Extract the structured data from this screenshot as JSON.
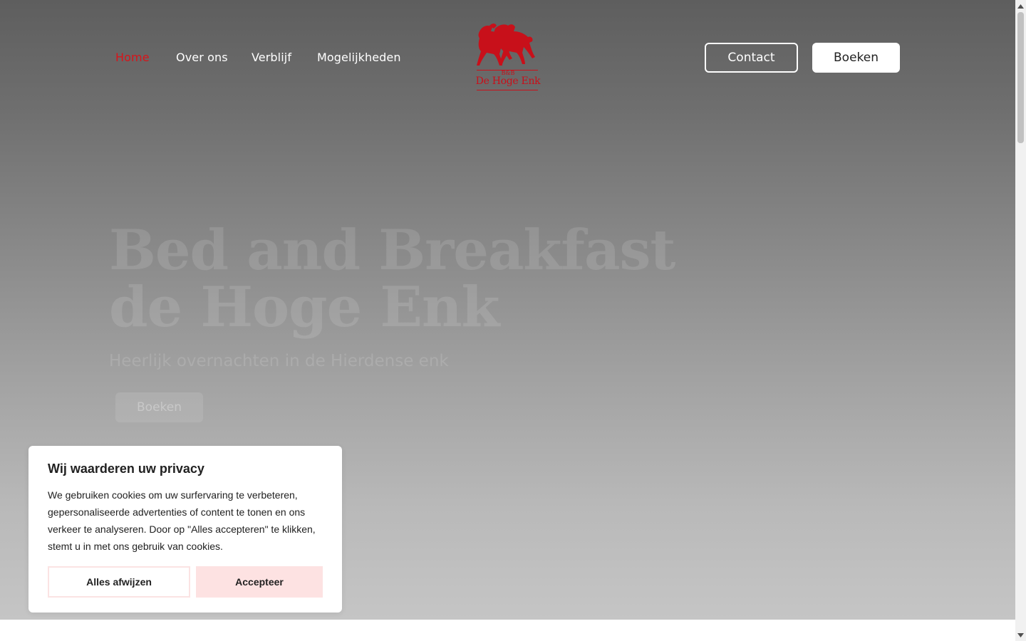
{
  "nav": {
    "items": [
      {
        "label": "Home"
      },
      {
        "label": "Over ons"
      },
      {
        "label": "Verblijf"
      },
      {
        "label": "Mogelijkheden"
      }
    ],
    "contact_label": "Contact",
    "book_label": "Boeken"
  },
  "logo": {
    "small": "B&B",
    "name": "De Hoge Enk",
    "icon": "horses-logo-icon",
    "color": "#c8101a"
  },
  "hero": {
    "title_line1": "Bed and Breakfast",
    "title_line2": "de Hoge Enk",
    "subtitle": "Heerlijk overnachten in de Hierdense enk",
    "button_label": "Boeken"
  },
  "cookie": {
    "title": "Wij waarderen uw privacy",
    "text": "We gebruiken cookies om uw surfervaring te verbeteren, gepersonaliseerde advertenties of content te tonen en ons verkeer te analyseren. Door op \"Alles accepteren\" te klikken, stemt u in met ons gebruik van cookies.",
    "reject_label": "Alles afwijzen",
    "accept_label": "Accepteer"
  },
  "colors": {
    "accent": "#d8141a",
    "accept_bg": "#fde2e2"
  }
}
